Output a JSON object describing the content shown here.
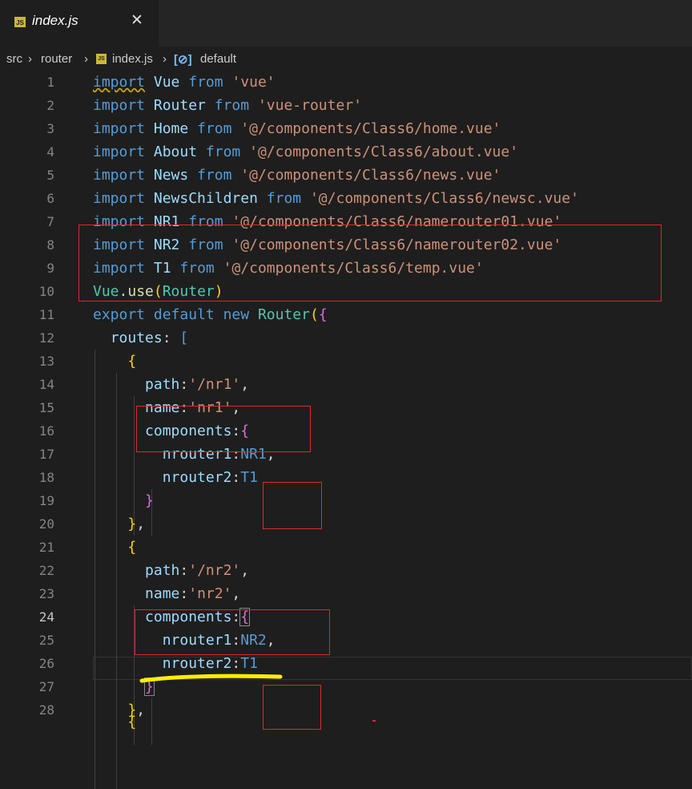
{
  "tab": {
    "title": "index.js",
    "file_icon": "JS",
    "close_glyph": "✕"
  },
  "breadcrumb": {
    "seg1": "src",
    "seg2": "router",
    "seg3": "index.js",
    "seg4": "default",
    "sep": "›",
    "file_icon": "JS",
    "symbol_icon": "[⊘]"
  },
  "editor": {
    "active_line": 24,
    "line_numbers": [
      "1",
      "2",
      "3",
      "4",
      "5",
      "6",
      "7",
      "8",
      "9",
      "10",
      "11",
      "12",
      "13",
      "14",
      "15",
      "16",
      "17",
      "18",
      "19",
      "20",
      "21",
      "22",
      "23",
      "24",
      "25",
      "26",
      "27",
      "28"
    ],
    "lines": [
      "import Vue from 'vue'",
      "import Router from 'vue-router'",
      "import Home from '@/components/Class6/home.vue'",
      "import About from '@/components/Class6/about.vue'",
      "import News from '@/components/Class6/news.vue'",
      "import NewsChildren from '@/components/Class6/newsc.vue'",
      "import NR1 from '@/components/Class6/namerouter01.vue'",
      "import NR2 from '@/components/Class6/namerouter02.vue'",
      "import T1 from '@/components/Class6/temp.vue'",
      "Vue.use(Router)",
      "export default new Router({",
      "  routes: [",
      "    {",
      "      path:'/nr1',",
      "      name:'nr1',",
      "      components:{",
      "        nrouter1:NR1,",
      "        nrouter2:T1",
      "      }",
      "    },",
      "    {",
      "      path:'/nr2',",
      "      name:'nr2',",
      "      components:{",
      "        nrouter1:NR2,",
      "        nrouter2:T1",
      "      }",
      "    },"
    ]
  },
  "colors": {
    "background": "#1e1e1e",
    "keyword": "#569cd6",
    "string": "#ce9178",
    "property": "#9cdcfe",
    "class": "#4ec9b0",
    "function": "#dcdcaa",
    "annotation_box": "#e0272d",
    "annotation_underline": "#ffee00"
  }
}
